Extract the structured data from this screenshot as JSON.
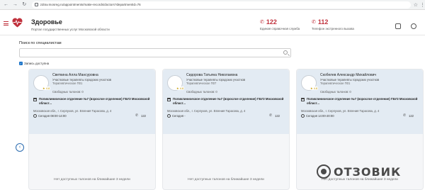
{
  "browser": {
    "url": "zdrav.mosreg.ru/appointments/make-records/doctors?departmentId=76"
  },
  "header": {
    "title": "Здоровье",
    "subtitle": "Портал государственных услуг Московской области",
    "phone1": {
      "number": "122",
      "desc": "Единая справочная служба"
    },
    "phone2": {
      "number": "112",
      "desc": "Телефон экстренного вызова"
    },
    "brand_color": "#c0313c"
  },
  "search": {
    "label": "Поиск по специалистам",
    "placeholder": "",
    "value": "",
    "checkbox_label": "Запись доступна",
    "checked": true
  },
  "doctors": [
    {
      "name": "Светкина Алла Мансуровна",
      "spec": "Участковые терапевты городских участков",
      "role": "Терапевтическое П01",
      "free": "Свободных талонов: 0",
      "rating": "4.8",
      "hospital": "Поликлиническое отделение №7 (взрослое отделение) ГБУЗ Московской област...",
      "address": "Московская обл., г. Серпухов, ул. Евгения Тарасова, д. 4",
      "hours": "Сегодня 08:00-14:00",
      "phone": "122",
      "no_tickets": "Нет доступных талонов на ближайшие 3 недели"
    },
    {
      "name": "Сидорова Татьяна Николаевна",
      "spec": "Участковые терапевты городских участков",
      "role": "Терапевтическое П07",
      "free": "Свободных талонов: 0",
      "rating": "4.8",
      "hospital": "Поликлиническое отделение №7 (взрослое отделение) ГБУЗ Московской област...",
      "address": "Московская обл., г. Серпухов, ул. Евгения Тарасова, д. 4",
      "hours": "Сегодня -",
      "phone": "122",
      "no_tickets": "Нет доступных талонов на ближайшие 3 недели"
    },
    {
      "name": "Скобелев Александр Михайлович",
      "spec": "Участковые терапевты городских участков",
      "role": "Терапевтическое П01",
      "free": "Свободных талонов: 0",
      "rating": "4.8",
      "hospital": "Поликлиническое отделение №7 (взрослое отделение) ГБУЗ Московской област...",
      "address": "Московская обл., г. Серпухов, ул. Евгения Тарасова, д. 4",
      "hours": "Сегодня 14:00-20:00",
      "phone": "122",
      "no_tickets": "Нет доступных талонов на ближайшие 3 недели"
    }
  ],
  "watermark": {
    "text": "ОТЗОВИК"
  }
}
